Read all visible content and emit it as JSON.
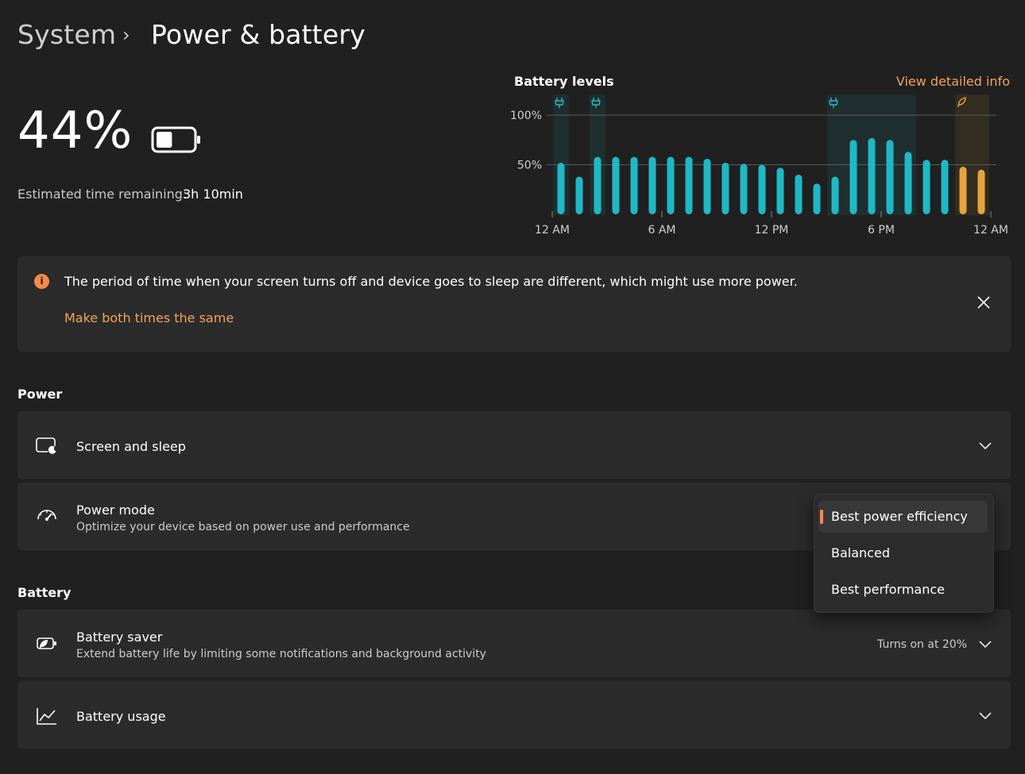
{
  "breadcrumb": {
    "parent": "System",
    "separator": "›",
    "current": "Power & battery"
  },
  "battery": {
    "percent_text": "44%",
    "level": 0.44,
    "estimate_label": "Estimated time remaining:",
    "estimate_value": "3h 10min"
  },
  "chart_data": {
    "type": "bar",
    "title": "Battery levels",
    "link": "View detailed info",
    "y_ticks": [
      "100%",
      "50%"
    ],
    "ylim": [
      0,
      100
    ],
    "x_ticks": [
      "12 AM",
      "6 AM",
      "12 PM",
      "6 PM",
      "12 AM"
    ],
    "series": [
      {
        "values": [
          52,
          38,
          58,
          58,
          58,
          58,
          58,
          58,
          56,
          52,
          51,
          50,
          47,
          40,
          31,
          38,
          75,
          77,
          75,
          63,
          55,
          55,
          48,
          45
        ]
      }
    ],
    "battery_saver_bars": [
      22,
      23
    ],
    "plugged_in_markers": [
      0,
      2,
      15
    ],
    "saver_marker": 22,
    "colors": {
      "normal": "#1fb8c4",
      "saver": "#e8a33d",
      "charging_band": "#1f3a3a",
      "saver_band": "#3a3322"
    }
  },
  "notice": {
    "icon": "info-icon",
    "text": "The period of time when your screen turns off and device goes to sleep are different, which might use more power.",
    "link": "Make both times the same"
  },
  "sections": {
    "power": "Power",
    "battery": "Battery"
  },
  "power_cards": {
    "screen_sleep": {
      "title": "Screen and sleep",
      "icon": "screen-sleep-icon"
    },
    "power_mode": {
      "title": "Power mode",
      "subtitle": "Optimize your device based on power use and performance",
      "icon": "gauge-icon"
    }
  },
  "power_mode_options": {
    "selected": "Best power efficiency",
    "items": [
      "Best power efficiency",
      "Balanced",
      "Best performance"
    ]
  },
  "battery_cards": {
    "saver": {
      "title": "Battery saver",
      "subtitle": "Extend battery life by limiting some notifications and background activity",
      "status": "Turns on at 20%",
      "icon": "battery-saver-icon"
    },
    "usage": {
      "title": "Battery usage",
      "icon": "chart-line-icon"
    }
  },
  "theme": {
    "background": "#202020",
    "card": "#2b2b2b",
    "accent": "#f7894a",
    "link": "#f2a35c"
  }
}
